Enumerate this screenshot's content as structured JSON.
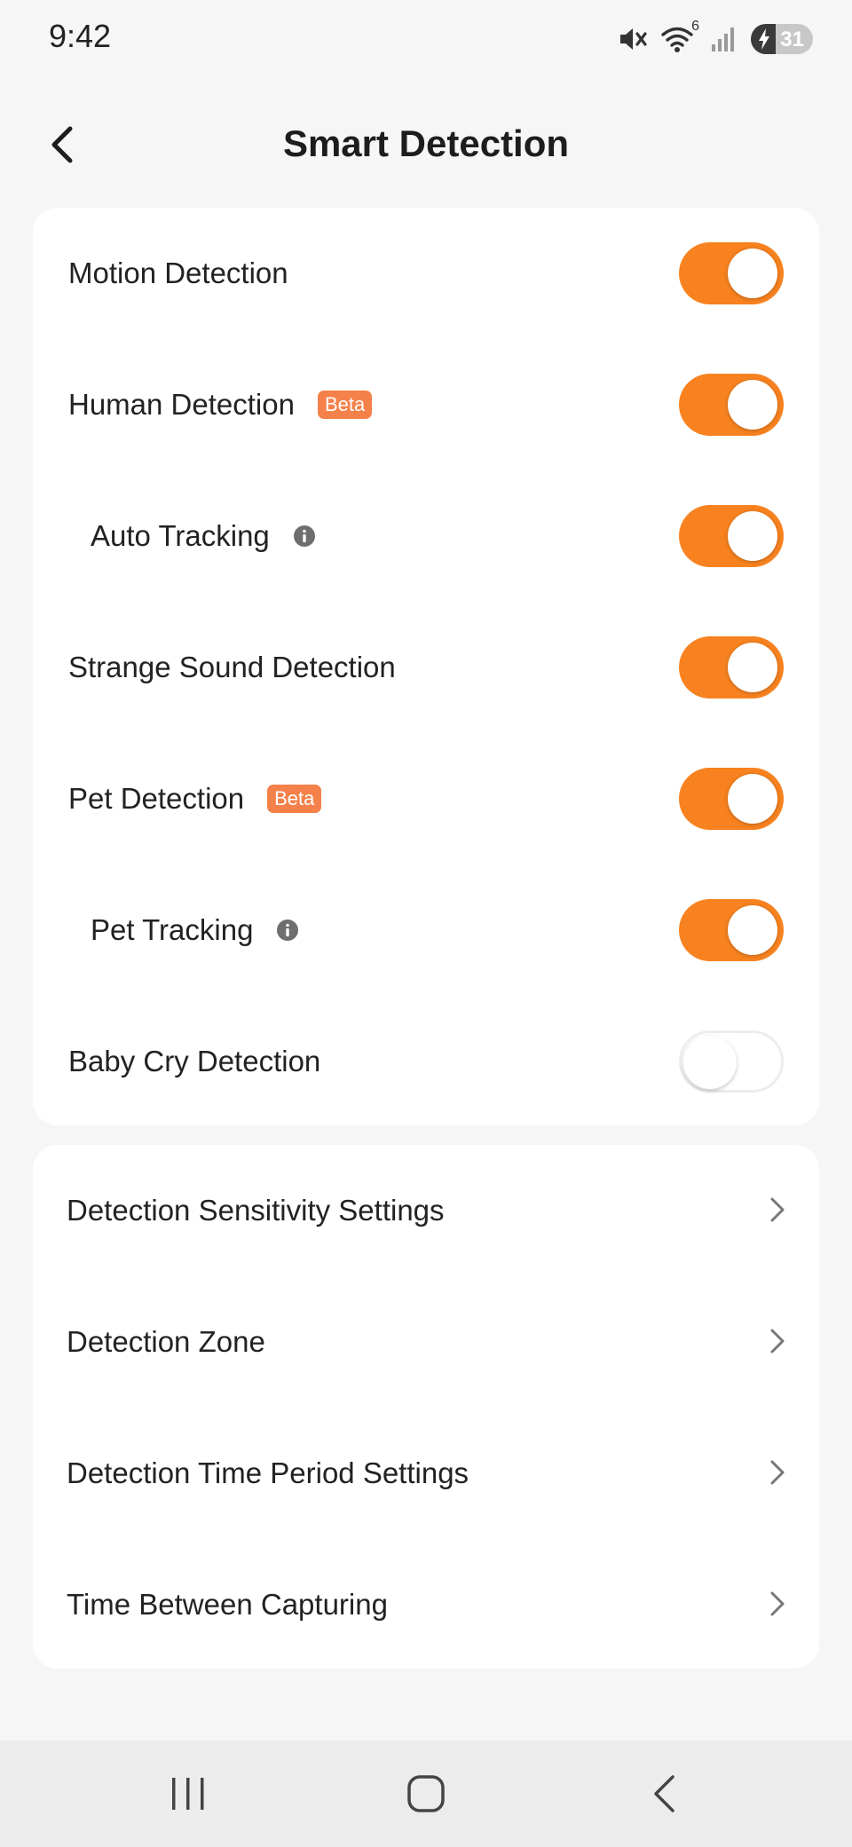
{
  "status_bar": {
    "time": "9:42",
    "wifi_badge": "6",
    "battery_level": "31",
    "icons": [
      "mute-icon",
      "wifi-icon",
      "signal-icon",
      "battery-icon"
    ]
  },
  "header": {
    "title": "Smart Detection",
    "back_icon": "back-arrow-icon"
  },
  "detection_toggles": [
    {
      "label": "Motion Detection",
      "on": true,
      "badge": "",
      "info": false,
      "sub": false
    },
    {
      "label": "Human Detection",
      "on": true,
      "badge": "Beta",
      "info": false,
      "sub": false
    },
    {
      "label": "Auto Tracking",
      "on": true,
      "badge": "",
      "info": true,
      "sub": true
    },
    {
      "label": "Strange Sound Detection",
      "on": true,
      "badge": "",
      "info": false,
      "sub": false
    },
    {
      "label": "Pet Detection",
      "on": true,
      "badge": "Beta",
      "info": false,
      "sub": false
    },
    {
      "label": "Pet Tracking",
      "on": true,
      "badge": "",
      "info": true,
      "sub": true
    },
    {
      "label": "Baby Cry Detection",
      "on": false,
      "badge": "",
      "info": false,
      "sub": false
    }
  ],
  "settings_links": [
    {
      "label": "Detection Sensitivity Settings"
    },
    {
      "label": "Detection Zone"
    },
    {
      "label": "Detection Time Period Settings"
    },
    {
      "label": "Time Between Capturing"
    }
  ],
  "colors": {
    "accent": "#f7821f",
    "badge": "#f5814a",
    "background": "#f6f6f6"
  },
  "system_nav": [
    "recents-icon",
    "home-icon",
    "back-icon"
  ]
}
